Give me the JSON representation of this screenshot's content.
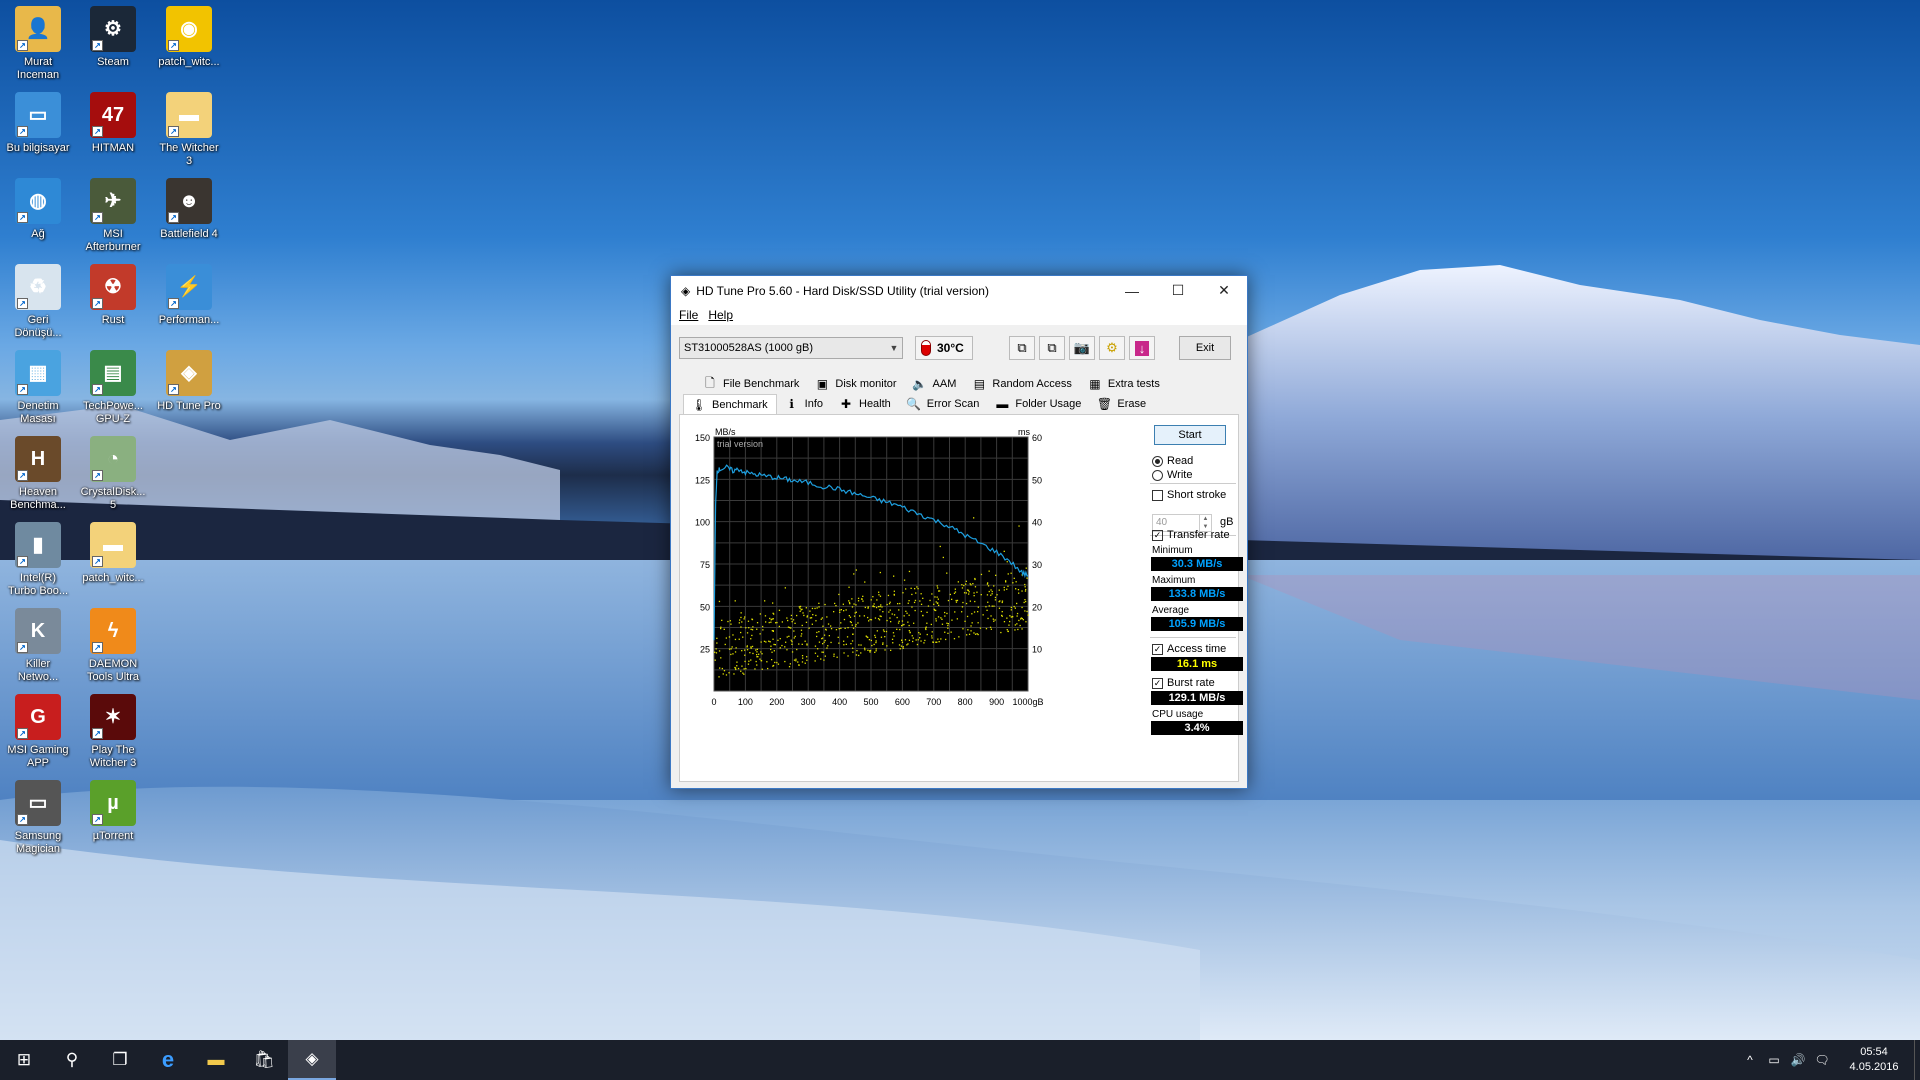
{
  "desktop_icons": [
    {
      "label": "Murat\nInceman",
      "icon": "user-folder-icon",
      "color": "#e8b84a",
      "glyph": "👤"
    },
    {
      "label": "Steam",
      "icon": "steam-icon",
      "color": "#1b2838",
      "glyph": "⚙"
    },
    {
      "label": "patch_witc...",
      "icon": "disc-image-icon",
      "color": "#f2c300",
      "glyph": "◉"
    },
    {
      "label": "Bu bilgisayar",
      "icon": "computer-icon",
      "color": "#3b8fd8",
      "glyph": "▭"
    },
    {
      "label": "HITMAN",
      "icon": "hitman-icon",
      "color": "#a50d0d",
      "glyph": "47"
    },
    {
      "label": "The Witcher\n3",
      "icon": "folder-icon",
      "color": "#f3d27a",
      "glyph": "▬"
    },
    {
      "label": "Ağ",
      "icon": "network-icon",
      "color": "#2e89d6",
      "glyph": "◍"
    },
    {
      "label": "MSI\nAfterburner",
      "icon": "afterburner-icon",
      "color": "#4a5a3a",
      "glyph": "✈"
    },
    {
      "label": "Battlefield 4",
      "icon": "battlefield-icon",
      "color": "#3a3530",
      "glyph": "☻"
    },
    {
      "label": "Geri\nDönüşü...",
      "icon": "recycle-bin-icon",
      "color": "#d8e4ee",
      "glyph": "♻"
    },
    {
      "label": "Rust",
      "icon": "rust-icon",
      "color": "#c23a2a",
      "glyph": "☢"
    },
    {
      "label": "Performan...",
      "icon": "performance-icon",
      "color": "#3a8ed8",
      "glyph": "⚡"
    },
    {
      "label": "Denetim\nMasası",
      "icon": "control-panel-icon",
      "color": "#4aa3e0",
      "glyph": "▦"
    },
    {
      "label": "TechPowe...\nGPU-Z",
      "icon": "gpuz-icon",
      "color": "#3a8a4a",
      "glyph": "▤"
    },
    {
      "label": "HD Tune Pro",
      "icon": "hdtune-icon",
      "color": "#d0a040",
      "glyph": "◈"
    },
    {
      "label": "Heaven\nBenchma...",
      "icon": "heaven-icon",
      "color": "#6a4a2a",
      "glyph": "H"
    },
    {
      "label": "CrystalDisk...\n5",
      "icon": "crystaldisk-icon",
      "color": "#8ab080",
      "glyph": "◔"
    },
    {
      "label": "Intel(R)\nTurbo Boo...",
      "icon": "intel-turbo-icon",
      "color": "#6f8aa0",
      "glyph": "▮"
    },
    {
      "label": "patch_witc...",
      "icon": "folder-icon",
      "color": "#f3d27a",
      "glyph": "▬"
    },
    {
      "label": "Killer\nNetwo...",
      "icon": "killer-icon",
      "color": "#7a8a9a",
      "glyph": "K"
    },
    {
      "label": "DAEMON\nTools Ultra",
      "icon": "daemon-icon",
      "color": "#f08a1a",
      "glyph": "ϟ"
    },
    {
      "label": "MSI Gaming\nAPP",
      "icon": "msi-gaming-icon",
      "color": "#c81e1e",
      "glyph": "G"
    },
    {
      "label": "Play The\nWitcher 3",
      "icon": "witcher-icon",
      "color": "#5a0a0a",
      "glyph": "✶"
    },
    {
      "label": "Samsung\nMagician",
      "icon": "samsung-icon",
      "color": "#555",
      "glyph": "▭"
    },
    {
      "label": "µTorrent",
      "icon": "utorrent-icon",
      "color": "#5aa02a",
      "glyph": "µ"
    }
  ],
  "window": {
    "title": "HD Tune Pro 5.60 - Hard Disk/SSD Utility (trial version)",
    "menu": [
      "File",
      "Help"
    ],
    "drive": "ST31000528AS (1000 gB)",
    "temperature": "30°C",
    "exit_label": "Exit",
    "tabs_row1": [
      {
        "label": "File Benchmark",
        "icon": "file-benchmark-icon",
        "glyph": "🗋"
      },
      {
        "label": "Disk monitor",
        "icon": "disk-monitor-icon",
        "glyph": "▣"
      },
      {
        "label": "AAM",
        "icon": "speaker-icon",
        "glyph": "🔈"
      },
      {
        "label": "Random Access",
        "icon": "random-access-icon",
        "glyph": "▤"
      },
      {
        "label": "Extra tests",
        "icon": "extra-tests-icon",
        "glyph": "▦"
      }
    ],
    "tabs_row2": [
      {
        "label": "Benchmark",
        "icon": "benchmark-icon",
        "glyph": "🌡"
      },
      {
        "label": "Info",
        "icon": "info-icon",
        "glyph": "ℹ"
      },
      {
        "label": "Health",
        "icon": "health-icon",
        "glyph": "✚"
      },
      {
        "label": "Error Scan",
        "icon": "error-scan-icon",
        "glyph": "🔍"
      },
      {
        "label": "Folder Usage",
        "icon": "folder-usage-icon",
        "glyph": "▬"
      },
      {
        "label": "Erase",
        "icon": "erase-icon",
        "glyph": "🗑"
      }
    ],
    "start_label": "Start",
    "read_label": "Read",
    "write_label": "Write",
    "short_stroke_label": "Short stroke",
    "short_stroke_value": "40",
    "gb_label": "gB",
    "transfer_rate_label": "Transfer rate",
    "minimum_label": "Minimum",
    "minimum_value": "30.3 MB/s",
    "maximum_label": "Maximum",
    "maximum_value": "133.8 MB/s",
    "average_label": "Average",
    "average_value": "105.9 MB/s",
    "access_time_label": "Access time",
    "access_time_value": "16.1 ms",
    "burst_rate_label": "Burst rate",
    "burst_rate_value": "129.1 MB/s",
    "cpu_usage_label": "CPU usage",
    "cpu_usage_value": "3.4%"
  },
  "chart_data": {
    "type": "line",
    "watermark": "trial version",
    "ylabel_left": "MB/s",
    "ylabel_right": "ms",
    "ylim": [
      0,
      150
    ],
    "ylim_right": [
      0,
      60
    ],
    "y_ticks": [
      25,
      50,
      75,
      100,
      125,
      150
    ],
    "y_ticks_right": [
      10,
      20,
      30,
      40,
      50,
      60
    ],
    "x_ticks": [
      "0",
      "100",
      "200",
      "300",
      "400",
      "500",
      "600",
      "700",
      "800",
      "900",
      "1000gB"
    ],
    "xlim": [
      0,
      1000
    ],
    "grid": true,
    "series": [
      {
        "name": "Transfer rate",
        "color": "#1ea0e0",
        "x": [
          0,
          5,
          10,
          20,
          40,
          60,
          80,
          100,
          130,
          160,
          200,
          230,
          260,
          300,
          340,
          380,
          420,
          460,
          500,
          540,
          580,
          620,
          660,
          700,
          740,
          780,
          820,
          860,
          900,
          940,
          980,
          1000
        ],
        "y": [
          30,
          110,
          130,
          131,
          132,
          130,
          131,
          129,
          128,
          127,
          126,
          125,
          124,
          123,
          121,
          120,
          118,
          116,
          114,
          112,
          110,
          107,
          104,
          101,
          98,
          94,
          90,
          86,
          82,
          77,
          70,
          68
        ]
      },
      {
        "name": "Access time",
        "color": "#e0e000",
        "type": "scatter",
        "range_ms": [
          3,
          45
        ]
      }
    ]
  },
  "taskbar": {
    "items": [
      {
        "icon": "windows-start-icon",
        "glyph": "⊞"
      },
      {
        "icon": "search-icon",
        "glyph": "⚲"
      },
      {
        "icon": "task-view-icon",
        "glyph": "❐"
      },
      {
        "icon": "edge-icon",
        "glyph": "e"
      },
      {
        "icon": "file-explorer-icon",
        "glyph": "▬"
      },
      {
        "icon": "store-icon",
        "glyph": "🛍"
      },
      {
        "icon": "hdtune-taskbar-icon",
        "glyph": "◈"
      }
    ],
    "tray": [
      {
        "icon": "chevron-up-icon",
        "glyph": "^"
      },
      {
        "icon": "network-tray-icon",
        "glyph": "▭"
      },
      {
        "icon": "volume-icon",
        "glyph": "🔊"
      },
      {
        "icon": "notification-icon",
        "glyph": "🗨"
      }
    ],
    "time": "05:54",
    "date": "4.05.2016"
  }
}
